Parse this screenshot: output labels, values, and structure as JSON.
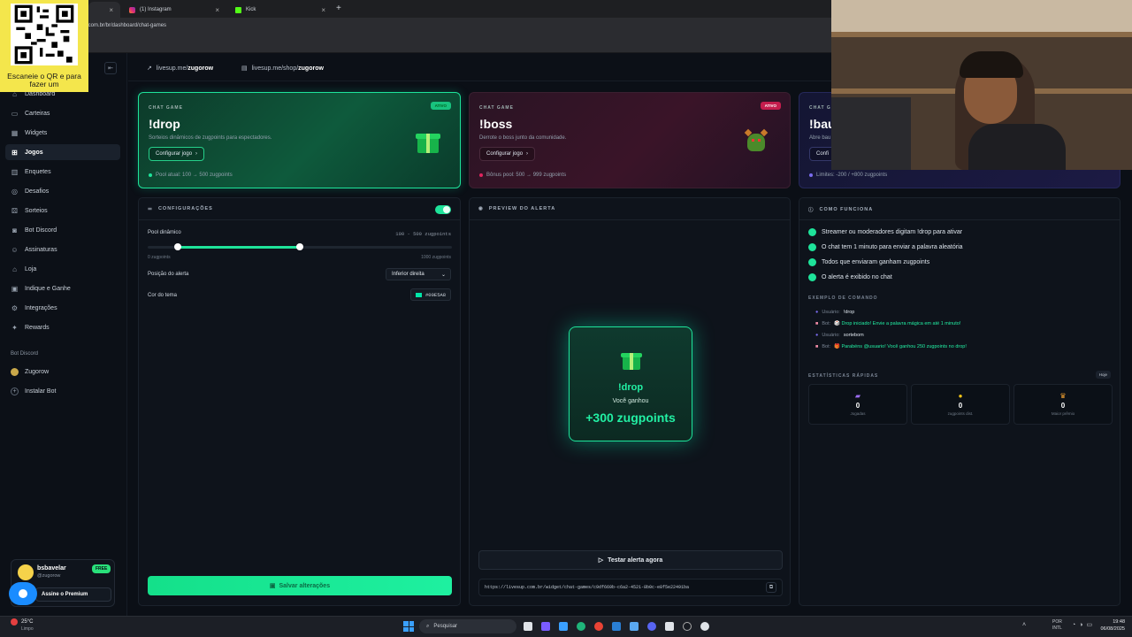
{
  "browser": {
    "tabs": [
      {
        "label": ""
      },
      {
        "label": "(1) Instagram"
      },
      {
        "label": "Kick"
      }
    ],
    "new_tab": "+",
    "url": ".com.br/br/dashboard/chat-games"
  },
  "qr_overlay": {
    "text": "Escaneie o QR e para fazer um"
  },
  "sidebar": {
    "items": [
      {
        "label": "Dashboard"
      },
      {
        "label": "Carteiras"
      },
      {
        "label": "Widgets"
      },
      {
        "label": "Jogos"
      },
      {
        "label": "Enquetes"
      },
      {
        "label": "Desafios"
      },
      {
        "label": "Sorteios"
      },
      {
        "label": "Bot Discord"
      },
      {
        "label": "Assinaturas"
      },
      {
        "label": "Loja"
      },
      {
        "label": "Indique e Ganhe"
      },
      {
        "label": "Integrações"
      },
      {
        "label": "Rewards"
      }
    ],
    "bot_section": "Bot Discord",
    "bot_items": [
      {
        "label": "Zugorow"
      },
      {
        "label": "Instalar Bot"
      }
    ],
    "user": {
      "name": "bsbavelar",
      "handle": "@zugorow",
      "plan_badge": "FREE",
      "premium_button": "Assine o Premium"
    }
  },
  "links": [
    {
      "prefix": "livesup.me/",
      "bold": "zugorow"
    },
    {
      "prefix": "livesup.me/shop/",
      "bold": "zugorow"
    }
  ],
  "game_cards": [
    {
      "label": "CHAT GAME",
      "title": "!drop",
      "desc": "Sorteios dinâmicos de zugpoints para espectadores.",
      "button": "Configurar jogo",
      "footer": "Pool atual: 100 → 500 zugpoints",
      "badge": "ATIVO",
      "accent": "#00E5A8"
    },
    {
      "label": "CHAT GAME",
      "title": "!boss",
      "desc": "Derrote o boss junto da comunidade.",
      "button": "Configurar jogo",
      "footer": "Bônus pool: 500 → 999 zugpoints",
      "badge": "ATIVO",
      "accent": "#e0245e"
    },
    {
      "label": "CHAT GA",
      "title": "!bau",
      "desc": "Abre bau",
      "button": "Confi",
      "footer": "Limites: -200 / +800 zugpoints",
      "badge": "",
      "accent": "#6c5ce7"
    }
  ],
  "config": {
    "header": "CONFIGURAÇÕES",
    "pool_label": "Pool dinâmico",
    "pool_range": "100 - 500 zugpoints",
    "slider_min": "0 zugpoints",
    "slider_max": "1000 zugpoints",
    "slider_low_fraction": 0.1,
    "slider_high_fraction": 0.5,
    "position_label": "Posição do alerta",
    "position_value": "Inferior direita",
    "color_label": "Cor do tema",
    "color_value": "#00E5A8",
    "save_button": "Salvar alterações"
  },
  "preview": {
    "header": "PREVIEW DO ALERTA",
    "alert_title": "!drop",
    "alert_sub": "Você ganhou",
    "alert_amount": "+300 zugpoints",
    "test_button": "Testar alerta agora",
    "widget_url": "https://livesup.com.br/widget/chat-games/c9df669b-c6a2-4521-8b0c-e8f5e22491ba"
  },
  "how": {
    "header": "COMO FUNCIONA",
    "steps": [
      "Streamer ou moderadores digitam !drop para ativar",
      "O chat tem 1 minuto para enviar a palavra aleatória",
      "Todos que enviaram ganham zugpoints",
      "O alerta é exibido no chat"
    ],
    "example_header": "EXEMPLO DE COMANDO",
    "example_lines": [
      {
        "who": "Usuário:",
        "text": "!drop",
        "bot": false
      },
      {
        "who": "Bot:",
        "text": "🎲 Drop iniciado! Envie a palavra mágica em até 1 minuto!",
        "bot": true
      },
      {
        "who": "Usuário:",
        "text": "sortebom",
        "bot": false
      },
      {
        "who": "Bot:",
        "text": "🎁 Parabéns @usuario! Você ganhou 250 zugpoints no drop!",
        "bot": true
      }
    ],
    "stats_header": "ESTATÍSTICAS RÁPIDAS",
    "stats_badge": "Hoje",
    "stats": [
      {
        "value": "0",
        "label": "Jogadas"
      },
      {
        "value": "0",
        "label": "zugpoints dist."
      },
      {
        "value": "0",
        "label": "Maior prêmio"
      }
    ]
  },
  "taskbar": {
    "weather_temp": "25°C",
    "weather_desc": "Limpo",
    "search": "Pesquisar",
    "lang1": "POR",
    "lang2": "INTL",
    "time": "19:48",
    "date": "06/08/2025"
  }
}
